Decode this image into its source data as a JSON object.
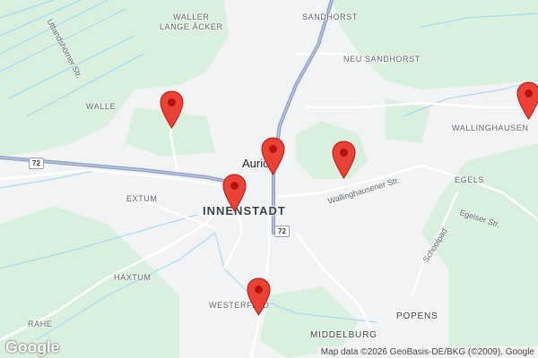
{
  "map": {
    "city": "Aurich",
    "districts": {
      "innenstadt": "INNENSTADT",
      "waller_lange_acker": "WALLER\nLANGE ÄCKER",
      "sandhorst": "SANDHORST",
      "neu_sandhorst": "NEU SANDHORST",
      "walle": "WALLE",
      "wallinghausen": "WALLINGHAUSEN",
      "egels": "EGELS",
      "extum": "EXTUM",
      "haxtum": "HAXTUM",
      "rahe": "RAHE",
      "westerfeld": "WESTERFELD",
      "popens": "POPENS",
      "middelburg": "MIDDELBURG"
    },
    "streets": {
      "uttandshorner": "Uttandshörner Str.",
      "wallinghausener": "Wallinghausener Str.",
      "egelser": "Egelser Str.",
      "schoolpad": "Schoolpad"
    },
    "route_shields": [
      "72",
      "72"
    ],
    "markers": [
      {
        "name": "marker-walle"
      },
      {
        "name": "marker-aurich-center"
      },
      {
        "name": "marker-east"
      },
      {
        "name": "marker-innenstadt"
      },
      {
        "name": "marker-westerfeld"
      },
      {
        "name": "marker-wallinghausen-edge"
      }
    ],
    "logo": "Google",
    "attribution": "Map data ©2026 GeoBasis-DE/BKG (©2009), Google",
    "colors": {
      "green_area": "#d9f0de",
      "water": "#9ad7f5",
      "highway": "#8ea0c4",
      "marker": "#ea4335"
    }
  }
}
